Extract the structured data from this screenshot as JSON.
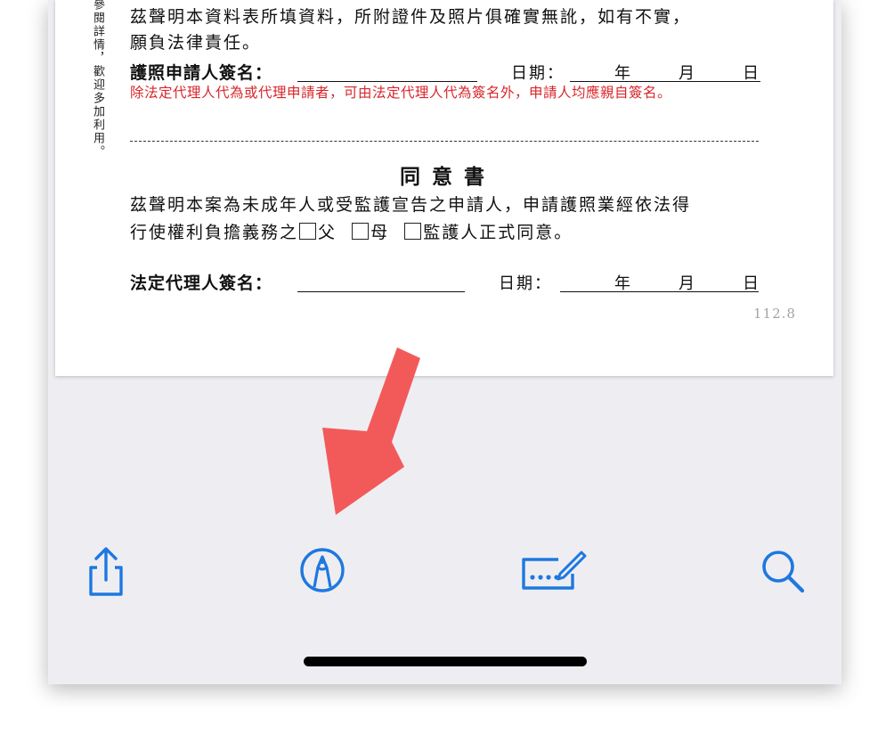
{
  "document": {
    "side_note": "參閱詳情，歡迎多加利用。",
    "declaration_line1": "茲聲明本資料表所填資料，所附證件及照片俱確實無訛，如有不實，",
    "declaration_line2": "願負法律責任。",
    "applicant_sign_label": "護照申請人簽名：",
    "date_label": "日期：",
    "year": "年",
    "month": "月",
    "day": "日",
    "red_note": "除法定代理人代為或代理申請者，可由法定代理人代為簽名外，申請人均應親自簽名。",
    "consent_title": "同意書",
    "consent_line1": "茲聲明本案為未成年人或受監護宣告之申請人，申請護照業經依法得",
    "consent_line2_prefix": "行使權利負擔義務之",
    "opt_father": "父",
    "opt_mother": "母",
    "opt_guardian": "監護人正式同意。",
    "guardian_sign_label": "法定代理人簽名：",
    "version": "112.8"
  },
  "toolbar": {
    "items": [
      {
        "icon": "share-icon"
      },
      {
        "icon": "markup-icon"
      },
      {
        "icon": "fill-and-sign-icon"
      },
      {
        "icon": "search-icon"
      }
    ]
  },
  "colors": {
    "accent": "#1e78e0",
    "arrow": "#f25a5a",
    "red_text": "#d8262b",
    "toolbar_bg": "#eeeef2"
  }
}
